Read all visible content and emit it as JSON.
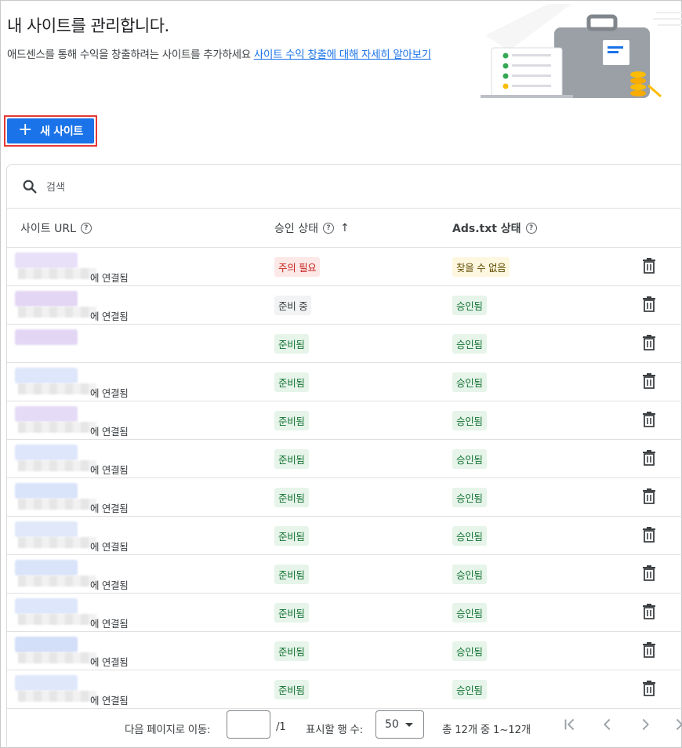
{
  "header": {
    "title": "내 사이트를 관리합니다.",
    "description": "애드센스를 통해 수익을 창출하려는 사이트를 추가하세요 ",
    "link": "사이트 수익 창출에 대해 자세히 알아보기"
  },
  "new_site_button": {
    "label": "새 사이트",
    "icon": "plus-icon"
  },
  "search": {
    "placeholder": "검색",
    "icon": "search-icon"
  },
  "table": {
    "columns": [
      {
        "label": "사이트 URL",
        "help": "?"
      },
      {
        "label": "승인 상태",
        "help": "?",
        "sort": "↑"
      },
      {
        "label": "Ads.txt 상태",
        "help": "?"
      }
    ],
    "rows": [
      {
        "linked": "에 연결됨",
        "status": "주의 필요",
        "status_type": "red",
        "ads": "찾을 수 없음",
        "ads_type": "yellow",
        "blur": "#e8dff8"
      },
      {
        "linked": "에 연결됨",
        "status": "준비 중",
        "status_type": "gray",
        "ads": "승인됨",
        "ads_type": "green",
        "blur": "#e3d6f5"
      },
      {
        "linked": "",
        "status": "준비됨",
        "status_type": "green",
        "ads": "승인됨",
        "ads_type": "green",
        "blur": "#e3d6f5"
      },
      {
        "linked": "에 연결됨",
        "status": "준비됨",
        "status_type": "green",
        "ads": "승인됨",
        "ads_type": "green",
        "blur": "#dde6fa"
      },
      {
        "linked": "에 연결됨",
        "status": "준비됨",
        "status_type": "green",
        "ads": "승인됨",
        "ads_type": "green",
        "blur": "#e6dbf6"
      },
      {
        "linked": "에 연결됨",
        "status": "준비됨",
        "status_type": "green",
        "ads": "승인됨",
        "ads_type": "green",
        "blur": "#dde6fa"
      },
      {
        "linked": "에 연결됨",
        "status": "준비됨",
        "status_type": "green",
        "ads": "승인됨",
        "ads_type": "green",
        "blur": "#d9e3fa"
      },
      {
        "linked": "에 연결됨",
        "status": "준비됨",
        "status_type": "green",
        "ads": "승인됨",
        "ads_type": "green",
        "blur": "#e0e8fa"
      },
      {
        "linked": "에 연결됨",
        "status": "준비됨",
        "status_type": "green",
        "ads": "승인됨",
        "ads_type": "green",
        "blur": "#d9e3fa"
      },
      {
        "linked": "에 연결됨",
        "status": "준비됨",
        "status_type": "green",
        "ads": "승인됨",
        "ads_type": "green",
        "blur": "#dde6fa"
      },
      {
        "linked": "에 연결됨",
        "status": "준비됨",
        "status_type": "green",
        "ads": "승인됨",
        "ads_type": "green",
        "blur": "#d3def8"
      },
      {
        "linked": "에 연결됨",
        "status": "준비됨",
        "status_type": "green",
        "ads": "승인됨",
        "ads_type": "green",
        "blur": "#dfe7fa"
      }
    ]
  },
  "pagination": {
    "goto_label": "다음 페이지로 이동:",
    "page_input": "",
    "total_pages": "/1",
    "rows_label": "표시할 행 수:",
    "rows_value": "50",
    "range_text": "총 12개 중 1~12개"
  },
  "colors": {
    "primary": "#1a73e8",
    "highlight_border": "#e53935"
  }
}
